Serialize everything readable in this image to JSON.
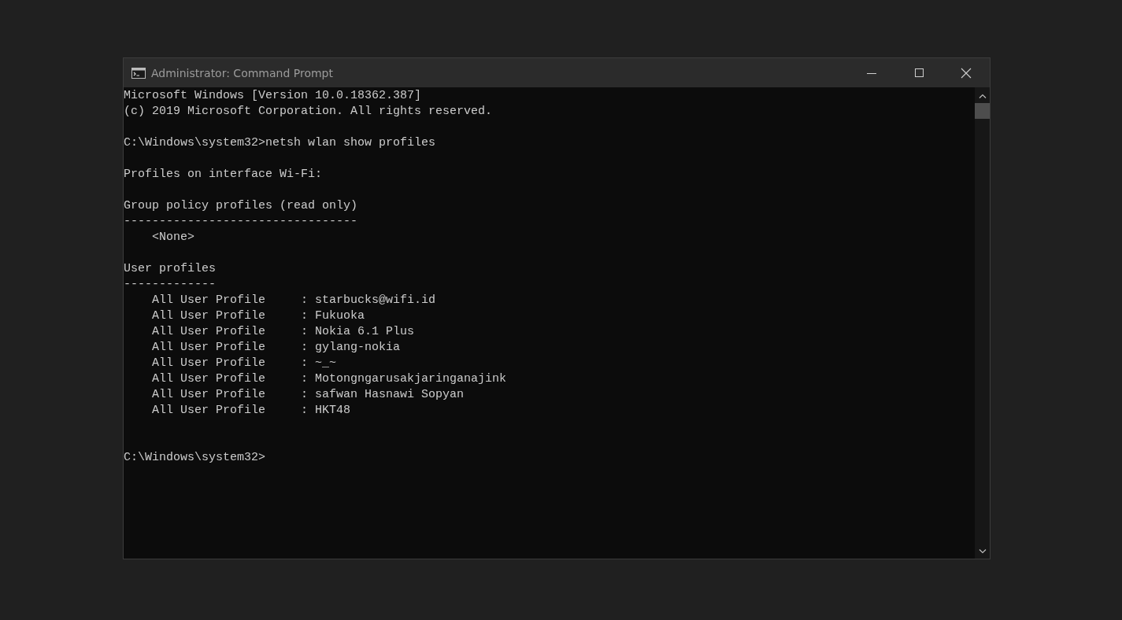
{
  "window": {
    "title": "Administrator: Command Prompt"
  },
  "console": {
    "lines": [
      {
        "kind": "text",
        "text": "Microsoft Windows [Version 10.0.18362.387]"
      },
      {
        "kind": "text",
        "text": "(c) 2019 Microsoft Corporation. All rights reserved."
      },
      {
        "kind": "blank"
      },
      {
        "kind": "text",
        "text": "C:\\Windows\\system32>netsh wlan show profiles"
      },
      {
        "kind": "blank"
      },
      {
        "kind": "text",
        "text": "Profiles on interface Wi-Fi:"
      },
      {
        "kind": "blank"
      },
      {
        "kind": "text",
        "text": "Group policy profiles (read only)"
      },
      {
        "kind": "text",
        "text": "---------------------------------"
      },
      {
        "kind": "text",
        "text": "    <None>"
      },
      {
        "kind": "blank"
      },
      {
        "kind": "text",
        "text": "User profiles"
      },
      {
        "kind": "text",
        "text": "-------------"
      },
      {
        "kind": "text",
        "text": "    All User Profile     : starbucks@wifi.id"
      },
      {
        "kind": "text",
        "text": "    All User Profile     : Fukuoka"
      },
      {
        "kind": "text",
        "text": "    All User Profile     : Nokia 6.1 Plus"
      },
      {
        "kind": "text",
        "text": "    All User Profile     : gylang-nokia"
      },
      {
        "kind": "text",
        "text": "    All User Profile     : ~_~"
      },
      {
        "kind": "text",
        "text": "    All User Profile     : Motongngarusakjaringanajink"
      },
      {
        "kind": "text",
        "text": "    All User Profile     : safwan Hasnawi Sopyan"
      },
      {
        "kind": "text",
        "text": "    All User Profile     : HKT48"
      },
      {
        "kind": "blank"
      },
      {
        "kind": "blank"
      },
      {
        "kind": "text",
        "text": "C:\\Windows\\system32>"
      }
    ]
  }
}
